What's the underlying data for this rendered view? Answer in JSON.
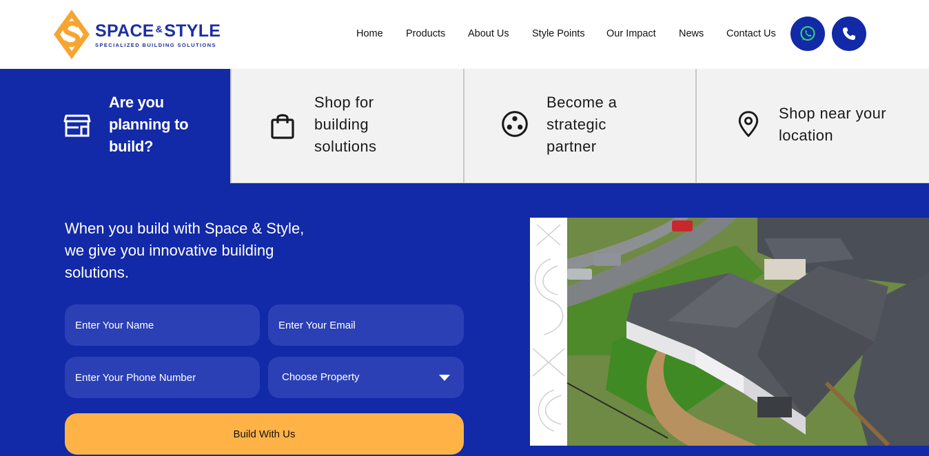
{
  "brand": {
    "name_part1": "SPACE",
    "amp": "&",
    "name_part2": "STYLE",
    "tagline": "SPECIALIZED BUILDING SOLUTIONS",
    "colors": {
      "primary": "#1229a8",
      "logo_orange": "#f7a531",
      "cta": "#ffb347"
    }
  },
  "nav": {
    "items": [
      "Home",
      "Products",
      "About Us",
      "Style Points",
      "Our Impact",
      "News",
      "Contact Us"
    ],
    "whatsapp_icon": "whatsapp-icon",
    "phone_icon": "phone-icon"
  },
  "tabs": [
    {
      "label": "Are you planning to build?",
      "lines": [
        "Are you",
        "planning to",
        "build?"
      ],
      "icon": "store-icon",
      "active": true
    },
    {
      "label": "Shop for building solutions",
      "lines": [
        "Shop for",
        "building",
        "solutions"
      ],
      "icon": "shopping-bag-icon",
      "active": false
    },
    {
      "label": "Become a strategic partner",
      "lines": [
        "Become a",
        "strategic",
        "partner"
      ],
      "icon": "partner-network-icon",
      "active": false
    },
    {
      "label": "Shop near your location",
      "lines": [
        "Shop near your",
        "location"
      ],
      "icon": "location-pin-icon",
      "active": false
    }
  ],
  "hero": {
    "lines": [
      "When you build with Space & Style,",
      "we give you innovative building",
      "solutions."
    ]
  },
  "form": {
    "name_placeholder": "Enter Your Name",
    "email_placeholder": "Enter Your Email",
    "phone_placeholder": "Enter Your Phone Number",
    "property_selected": "Choose Property",
    "submit_label": "Build With Us"
  }
}
